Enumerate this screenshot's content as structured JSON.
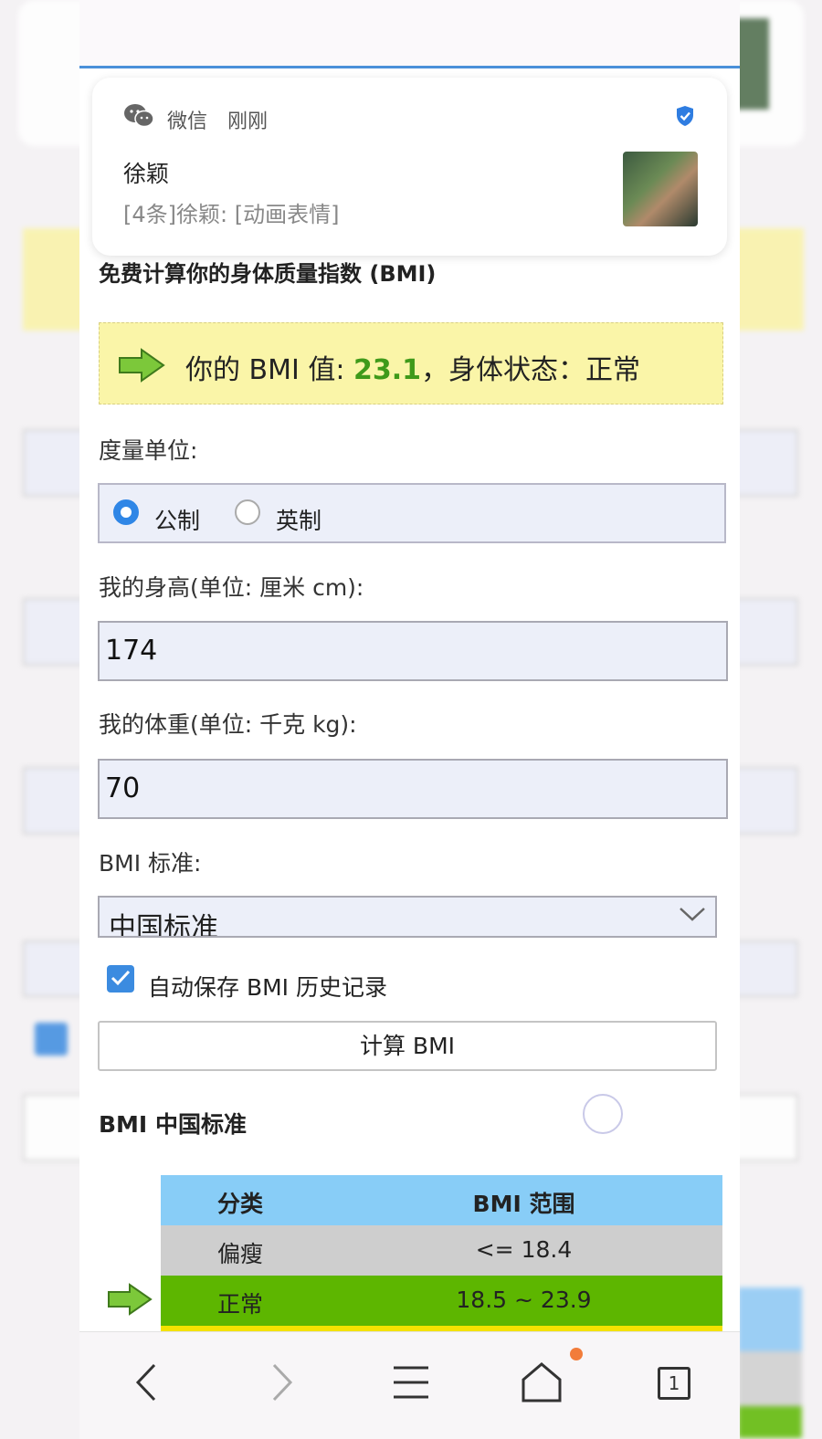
{
  "notification": {
    "app": "微信",
    "time": "刚刚",
    "sender": "徐颖",
    "message": "[4条]徐颖: [动画表情]"
  },
  "page": {
    "title": "免费计算你的身体质量指数 (BMI)",
    "result": {
      "prefix": "你的 BMI 值: ",
      "value": "23.1",
      "suffix": "，身体状态：正常",
      "value_color": "#3f9a1a"
    },
    "unit": {
      "label": "度量单位:",
      "options": [
        "公制",
        "英制"
      ],
      "selected": "公制"
    },
    "height": {
      "label": "我的身高(单位: 厘米 cm):",
      "value": "174"
    },
    "weight": {
      "label": "我的体重(单位: 千克 kg):",
      "value": "70"
    },
    "standard": {
      "label": "BMI 标准:",
      "selected": "中国标准"
    },
    "autosave": {
      "label": "自动保存 BMI 历史记录",
      "checked": true
    },
    "calc_button": "计算 BMI",
    "table_title": "BMI 中国标准",
    "table": {
      "headers": [
        "分类",
        "BMI 范围"
      ],
      "rows": [
        {
          "category": "偏瘦",
          "range": "<= 18.4",
          "color": "#cecece"
        },
        {
          "category": "正常",
          "range": "18.5 ~ 23.9",
          "color": "#5db600",
          "current": true
        }
      ]
    }
  },
  "navbar": {
    "items": [
      "back-icon",
      "forward-icon",
      "menu-icon",
      "home-icon",
      "tabs-icon"
    ],
    "tab_count": "1"
  }
}
